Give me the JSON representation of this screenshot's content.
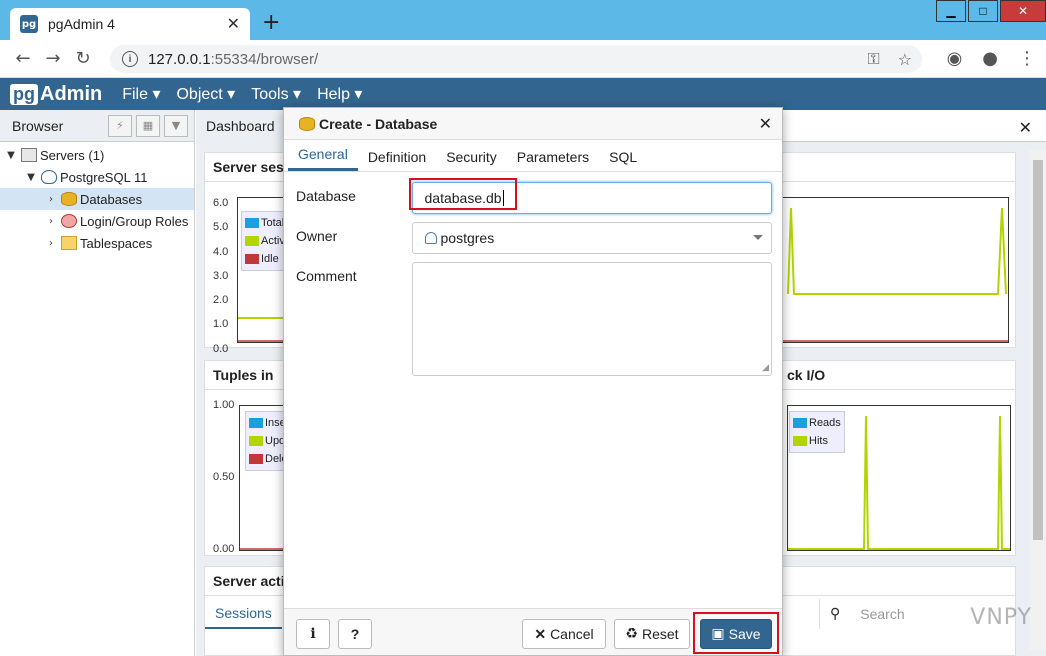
{
  "browser": {
    "tab_title": "pgAdmin 4",
    "tab_favicon": "pg",
    "url_host": "127.0.0.1",
    "url_rest": ":55334/browser/"
  },
  "pgadmin": {
    "logo_pg": "pg",
    "logo_admin": "Admin",
    "menu": [
      "File",
      "Object",
      "Tools",
      "Help"
    ]
  },
  "browser_panel": {
    "title": "Browser",
    "tree": [
      {
        "label": "Servers (1)",
        "level": 0,
        "toggle": "open",
        "icon": "server-icon"
      },
      {
        "label": "PostgreSQL 11",
        "level": 1,
        "toggle": "open",
        "icon": "postgres-elephant-icon"
      },
      {
        "label": "Databases",
        "level": 2,
        "toggle": "closed",
        "icon": "database-icon",
        "selected": true
      },
      {
        "label": "Login/Group Roles",
        "level": 2,
        "toggle": "closed",
        "icon": "roles-icon"
      },
      {
        "label": "Tablespaces",
        "level": 2,
        "toggle": "closed",
        "icon": "tablespace-icon"
      }
    ]
  },
  "dashboard": {
    "tab": "Dashboard",
    "server_sessions": {
      "title": "Server sess",
      "y_ticks": [
        "6.0",
        "5.0",
        "4.0",
        "3.0",
        "2.0",
        "1.0",
        "0.0"
      ],
      "legend": [
        "Total",
        "Activ",
        "Idle"
      ]
    },
    "tuples_in": {
      "title": "Tuples in",
      "y_ticks": [
        "1.00",
        "0.50",
        "0.00"
      ],
      "legend": [
        "Inse",
        "Upd",
        "Dele"
      ]
    },
    "block_io": {
      "title": "ck I/O",
      "legend": [
        "Reads",
        "Hits"
      ]
    },
    "server_activity": {
      "title": "Server activ",
      "tab": "Sessions",
      "search_placeholder": "Search"
    },
    "colors": {
      "total": "#1aa0e0",
      "active": "#b4d400",
      "idle": "#c03838"
    }
  },
  "dialog": {
    "title": "Create - Database",
    "tabs": [
      "General",
      "Definition",
      "Security",
      "Parameters",
      "SQL"
    ],
    "active_tab": "General",
    "fields": {
      "database_label": "Database",
      "database_value": "database.db",
      "owner_label": "Owner",
      "owner_value": "postgres",
      "comment_label": "Comment"
    },
    "buttons": {
      "info": "i",
      "help": "?",
      "cancel": "Cancel",
      "reset": "Reset",
      "save": "Save"
    }
  },
  "watermark": "VNPY"
}
